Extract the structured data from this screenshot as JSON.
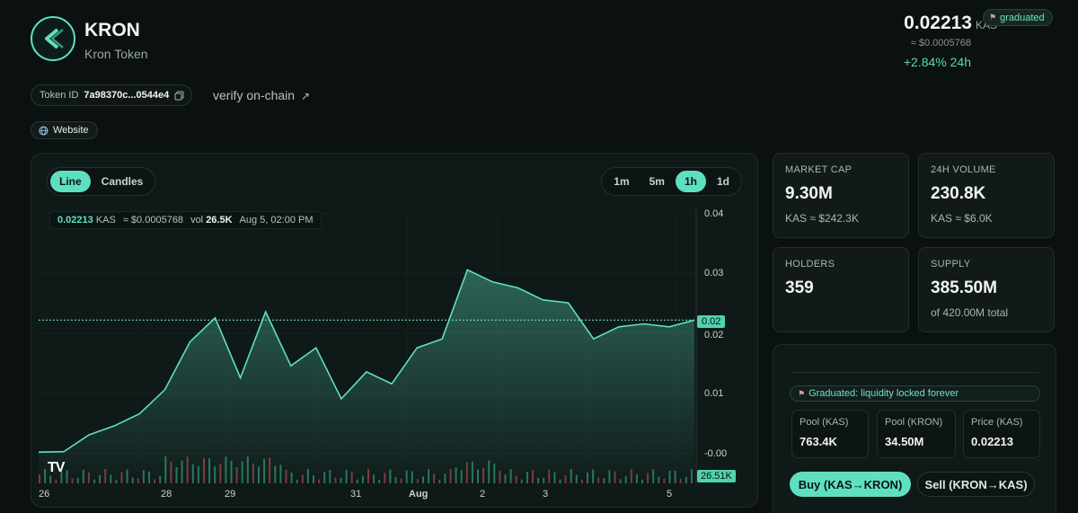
{
  "token": {
    "symbol": "KRON",
    "name": "Kron Token"
  },
  "price": {
    "value": "0.02213",
    "unit": "KAS",
    "usd": "≈ $0.0005768",
    "change_24h": "+2.84% 24h",
    "status_badge": "graduated"
  },
  "token_id": {
    "label": "Token ID",
    "value": "7a98370c...0544e4",
    "verify_label": "verify on-chain"
  },
  "links": {
    "website": "Website"
  },
  "chart": {
    "mode_tabs": [
      "Line",
      "Candles"
    ],
    "mode_active": "Line",
    "timeframes": [
      "1m",
      "5m",
      "1h",
      "1d"
    ],
    "timeframe_active": "1h",
    "infobar": {
      "price": "0.02213",
      "unit": "KAS",
      "usd": "≈ $0.0005768",
      "vol_label": "vol",
      "vol_value": "26.5K",
      "time": "Aug 5, 02:00 PM"
    },
    "y_ticks": [
      "0.04",
      "0.03",
      "0.02",
      "0.01",
      "-0.00"
    ],
    "x_ticks": [
      "26",
      "28",
      "29",
      "31",
      "Aug",
      "2",
      "3",
      "5"
    ],
    "last_price_label": "0.02",
    "volume_label": "26.51K",
    "colors": {
      "line": "#5ee0c0",
      "up_volume": "#2f9d7b",
      "down_volume": "#a8474b"
    }
  },
  "chart_data": {
    "type": "area",
    "title": "",
    "x_tick_labels": [
      "26",
      "28",
      "29",
      "31",
      "Aug",
      "2",
      "3",
      "5"
    ],
    "ylim": [
      0,
      0.04
    ],
    "y_tick_labels": [
      "0.04",
      "0.03",
      "0.02",
      "0.01",
      "-0.00"
    ],
    "current_price": 0.02213,
    "current_volume": "26.51K",
    "series": [
      {
        "name": "",
        "points": [
          [
            "Jul 26",
            0.0001
          ],
          [
            "Jul 26",
            0.0002
          ],
          [
            "Jul 27",
            0.003
          ],
          [
            "Jul 27",
            0.0045
          ],
          [
            "Jul 27",
            0.0065
          ],
          [
            "Jul 28",
            0.0105
          ],
          [
            "Jul 28",
            0.0185
          ],
          [
            "Jul 28",
            0.0225
          ],
          [
            "Jul 28",
            0.0125
          ],
          [
            "Jul 29",
            0.0235
          ],
          [
            "Jul 29",
            0.0145
          ],
          [
            "Jul 29",
            0.0175
          ],
          [
            "Jul 30",
            0.009
          ],
          [
            "Jul 30",
            0.0135
          ],
          [
            "Jul 31",
            0.0115
          ],
          [
            "Jul 31",
            0.0175
          ],
          [
            "Aug 1",
            0.019
          ],
          [
            "Aug 1",
            0.0305
          ],
          [
            "Aug 1",
            0.0285
          ],
          [
            "Aug 2",
            0.0275
          ],
          [
            "Aug 2",
            0.0255
          ],
          [
            "Aug 3",
            0.025
          ],
          [
            "Aug 3",
            0.019
          ],
          [
            "Aug 4",
            0.021
          ],
          [
            "Aug 4",
            0.0215
          ],
          [
            "Aug 5",
            0.021
          ],
          [
            "Aug 5",
            0.02213
          ]
        ]
      }
    ]
  },
  "stats": {
    "market_cap": {
      "title": "MARKET CAP",
      "value": "9.30M",
      "sub": "KAS ≈ $242.3K"
    },
    "volume_24h": {
      "title": "24H VOLUME",
      "value": "230.8K",
      "sub": "KAS ≈ $6.0K"
    },
    "holders": {
      "title": "HOLDERS",
      "value": "359",
      "sub": ""
    },
    "supply": {
      "title": "SUPPLY",
      "value": "385.50M",
      "sub": "of 420.00M total"
    }
  },
  "trade": {
    "graduated_banner": "Graduated: liquidity locked forever",
    "pools": [
      {
        "title": "Pool (KAS)",
        "value": "763.4K"
      },
      {
        "title": "Pool (KRON)",
        "value": "34.50M"
      },
      {
        "title": "Price (KAS)",
        "value": "0.02213"
      }
    ],
    "buy_label": "Buy (KAS→KRON)",
    "sell_label": "Sell (KRON→KAS)"
  }
}
